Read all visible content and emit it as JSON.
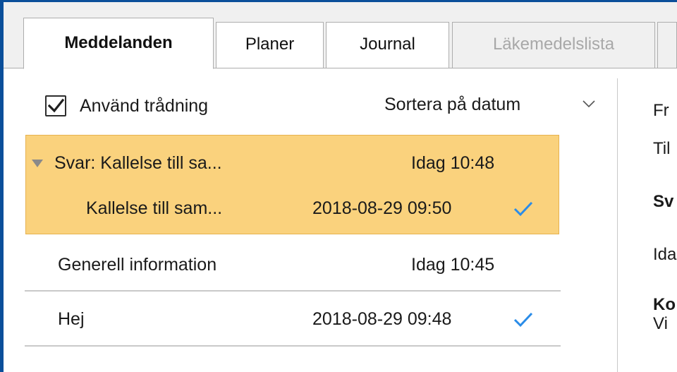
{
  "tabs": [
    {
      "label": "Meddelanden",
      "active": true
    },
    {
      "label": "Planer"
    },
    {
      "label": "Journal"
    },
    {
      "label": "Läkemedelslista",
      "disabled": true
    }
  ],
  "toolbar": {
    "threading_label": "Använd trådning",
    "threading_checked": true,
    "sort_label": "Sortera på datum"
  },
  "messages": [
    {
      "subject": "Svar: Kallelse till sa...",
      "date": "Idag 10:48",
      "read": false,
      "thread_parent": true,
      "selected": true
    },
    {
      "subject": "Kallelse till sam...",
      "date": "2018-08-29 09:50",
      "read": true,
      "thread_child": true,
      "selected": true
    },
    {
      "subject": "Generell information",
      "date": "Idag 10:45",
      "read": false
    },
    {
      "subject": "Hej",
      "date": "2018-08-29 09:48",
      "read": true
    }
  ],
  "preview": {
    "from_label": "Fr",
    "to_label": "Til",
    "subject_fragment": "Sv",
    "date_fragment": "Ida",
    "body_heading_fragment": "Ko",
    "body_text_fragment": "Vi"
  },
  "colors": {
    "selection": "#fad27d",
    "check_accent": "#2a8ce8",
    "window_border": "#0b4f9a"
  }
}
